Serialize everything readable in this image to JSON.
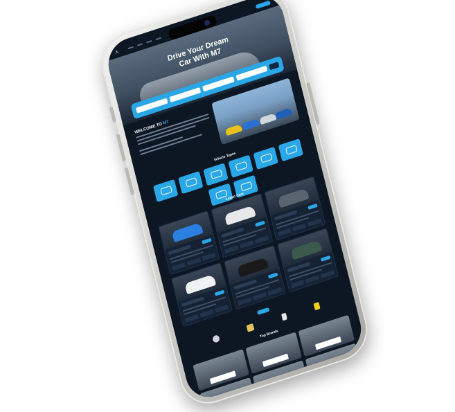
{
  "hero": {
    "title_line1": "Drive Your Dream",
    "title_line2": "Car With M7"
  },
  "welcome": {
    "title_prefix": "WELCOME TO",
    "title_brand": "M7"
  },
  "sections": {
    "vehicle_types": "Vehicle Types",
    "latest_cars": "Latest Cars",
    "top_brands": "Top Brands"
  },
  "colors": {
    "accent": "#2aa7e6",
    "background": "#0d1724",
    "card": "#152233",
    "phone_frame": "#cfcfcb"
  },
  "icons": [
    "logo-icon",
    "search-icon",
    "car-icon"
  ]
}
